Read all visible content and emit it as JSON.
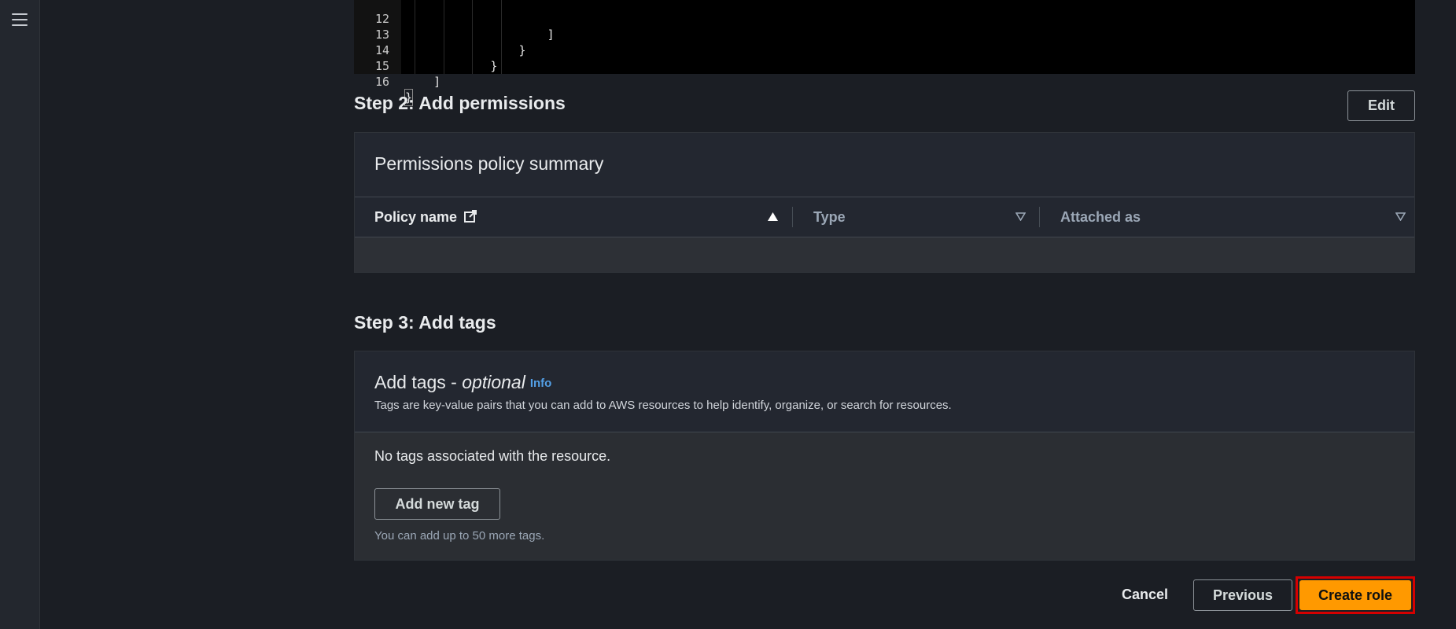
{
  "editor": {
    "lines": [
      {
        "num": "12",
        "text": "                    ]"
      },
      {
        "num": "13",
        "text": "                }"
      },
      {
        "num": "14",
        "text": "            }"
      },
      {
        "num": "15",
        "text": "    ]"
      },
      {
        "num": "16",
        "text": "}"
      }
    ]
  },
  "step2": {
    "title": "Step 2: Add permissions",
    "edit_label": "Edit",
    "card_title": "Permissions policy summary",
    "columns": {
      "policy_name": "Policy name",
      "type": "Type",
      "attached_as": "Attached as"
    }
  },
  "step3": {
    "title": "Step 3: Add tags",
    "card_title_main": "Add tags - ",
    "card_title_optional": "optional",
    "info_label": "Info",
    "description": "Tags are key-value pairs that you can add to AWS resources to help identify, organize, or search for resources.",
    "empty_message": "No tags associated with the resource.",
    "add_tag_label": "Add new tag",
    "limit_hint": "You can add up to 50 more tags."
  },
  "footer": {
    "cancel_label": "Cancel",
    "previous_label": "Previous",
    "create_label": "Create role"
  },
  "colors": {
    "primary_button": "#ff9900",
    "highlight_border": "#d60000",
    "info_link": "#539fe5"
  }
}
